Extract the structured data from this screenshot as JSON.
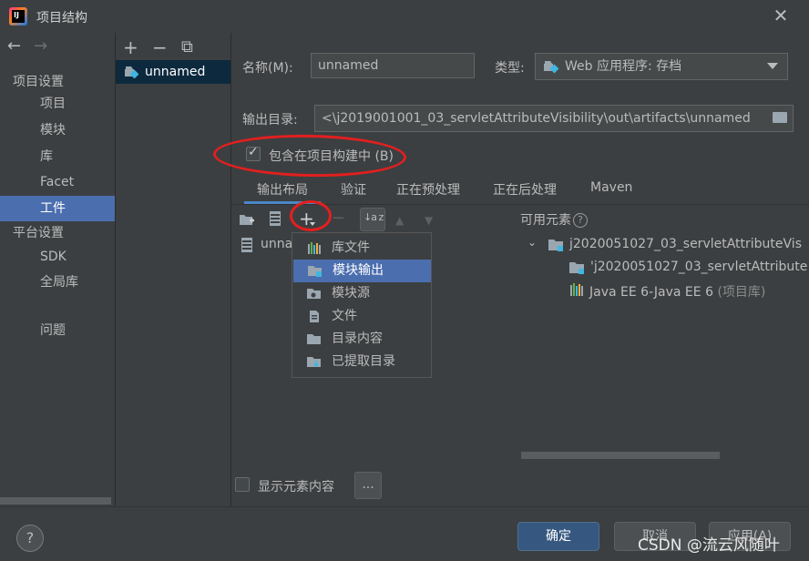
{
  "window": {
    "title": "项目结构",
    "close": "✕"
  },
  "nav": {
    "back": "←",
    "forward": "→"
  },
  "sidebar": {
    "groups": [
      {
        "label": "项目设置"
      },
      {
        "label": "平台设置"
      }
    ],
    "items": [
      {
        "label": "项目"
      },
      {
        "label": "模块"
      },
      {
        "label": "库"
      },
      {
        "label": "Facet"
      },
      {
        "label": "工件"
      },
      {
        "label": "SDK"
      },
      {
        "label": "全局库"
      },
      {
        "label": "问题"
      }
    ]
  },
  "artifacts": {
    "toolbar": {
      "add": "+",
      "remove": "−",
      "copy": "⧉"
    },
    "items": [
      {
        "label": "unnamed"
      }
    ]
  },
  "form": {
    "name_label": "名称(M):",
    "name_value": "unnamed",
    "type_label": "类型:",
    "type_value": "Web 应用程序: 存档",
    "output_label": "输出目录:",
    "output_value": "<\\j2019001001_03_servletAttributeVisibility\\out\\artifacts\\unnamed",
    "include_label": "包含在项目构建中 (B)",
    "include_checked": true
  },
  "tabs": [
    "输出布局",
    "验证",
    "正在预处理",
    "正在后处理",
    "Maven"
  ],
  "layout_toolbar": {
    "sort": "↓a z",
    "up": "▲",
    "down": "▼",
    "add": "+",
    "remove": "−"
  },
  "layout_tree": {
    "root": "unna"
  },
  "popup_menu": {
    "items": [
      {
        "label": "库文件",
        "icon": "library-icon"
      },
      {
        "label": "模块输出",
        "icon": "module-output-icon"
      },
      {
        "label": "模块源",
        "icon": "module-source-icon"
      },
      {
        "label": "文件",
        "icon": "file-icon"
      },
      {
        "label": "目录内容",
        "icon": "directory-icon"
      },
      {
        "label": "已提取目录",
        "icon": "extracted-dir-icon"
      }
    ],
    "highlighted_index": 1
  },
  "available": {
    "header": "可用元素",
    "help": "?",
    "tree": [
      {
        "label": "j2020051027_03_servletAttributeVis"
      },
      {
        "label": "'j2020051027_03_servletAttribute"
      },
      {
        "label": "Java EE 6-Java EE 6",
        "suffix": "(项目库)"
      }
    ]
  },
  "show_content": {
    "label": "显示元素内容",
    "checked": false,
    "more": "..."
  },
  "footer": {
    "help": "?",
    "ok": "确定",
    "cancel": "取消",
    "apply": "应用(A)",
    "watermark": "CSDN @流云风随叶"
  },
  "colors": {
    "accent": "#4b6eaf",
    "annotation": "#e31f1f",
    "background": "#3c3f41"
  }
}
